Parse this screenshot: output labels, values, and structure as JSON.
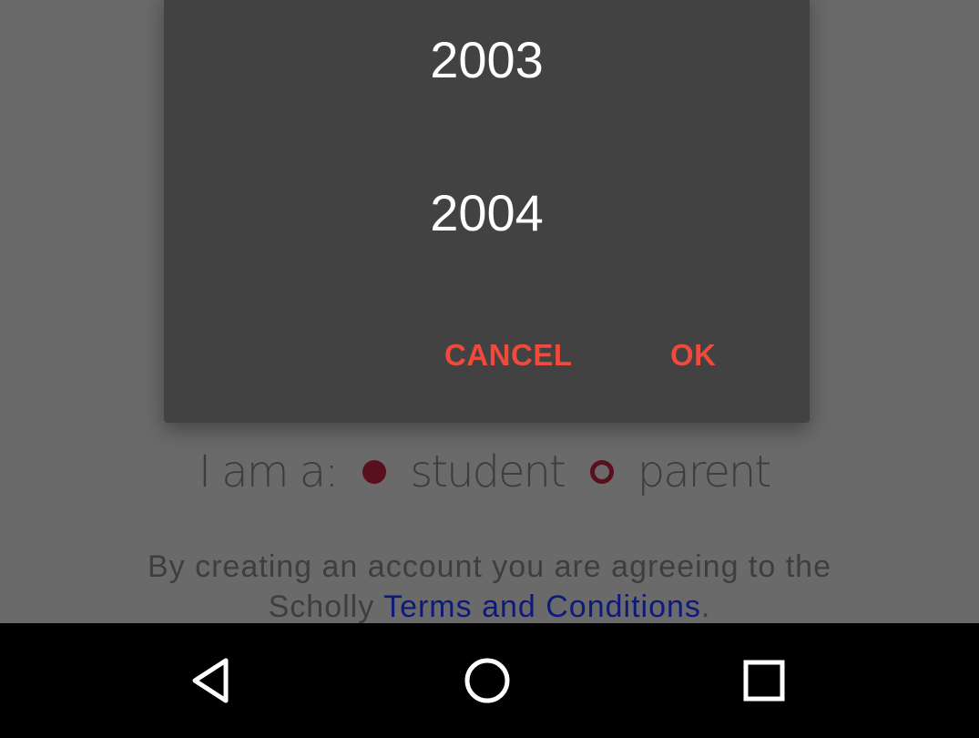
{
  "form": {
    "role_label": "I am a:",
    "role_options": [
      {
        "label": "student",
        "checked": true
      },
      {
        "label": "parent",
        "checked": false
      }
    ],
    "terms_prefix": "By creating an account you are agreeing to the",
    "terms_brand": "Scholly",
    "terms_link": "Terms and Conditions",
    "terms_suffix": "."
  },
  "year_picker": {
    "visible_years": [
      "2003",
      "2004"
    ],
    "cancel_label": "CANCEL",
    "ok_label": "OK"
  },
  "nav_bar": {
    "back_icon": "back-triangle-icon",
    "home_icon": "home-circle-icon",
    "recents_icon": "recents-square-icon"
  },
  "colors": {
    "dialog_bg": "#424242",
    "button_accent": "#ef4a3c",
    "radio": "#5a0f1c",
    "link": "#0e1a7a"
  }
}
